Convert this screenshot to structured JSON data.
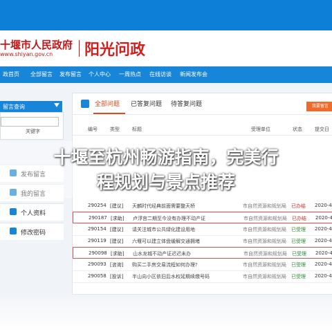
{
  "header": {
    "site_name": "十堰市人民政府",
    "site_url": "www.shiyan.gov.cn",
    "brand": "阳光问政"
  },
  "nav": [
    "政首页",
    "全部留言",
    "发布留言",
    "个人中心",
    "一周热点",
    "在线访谈",
    "新闻发布会"
  ],
  "sidebar": {
    "title": "留言查询",
    "check_label": "关键字",
    "buttons": [
      "发布留言",
      "我的留言",
      "个人资料",
      "修改密码"
    ]
  },
  "tabs": [
    "全部问题",
    "已答复问题",
    "待答复问题"
  ],
  "action_button": "我要留言",
  "table": {
    "headers": [
      "编号",
      "类型",
      "标题",
      "受理单位",
      "状态",
      "提交日"
    ],
    "rows": [
      {
        "id": "290254",
        "type": "[建议]",
        "title": "天麟时代经典前面需要整天桥",
        "dept": "市自然资源和规划局",
        "status": "已办结",
        "date": "2020-4-2",
        "highlight": false
      },
      {
        "id": "290187",
        "type": "[求助]",
        "title": "卢浮宫二期至今没有办理不动产证",
        "dept": "市自然资源和规划局",
        "status": "已办结",
        "date": "2020-4-2",
        "highlight": true
      },
      {
        "id": "290154",
        "type": "[建议]",
        "title": "请关注城市公共绿化建设用地",
        "dept": "市自然资源和规划局",
        "status": "已受理",
        "date": "2020-4-2",
        "highlight": false
      },
      {
        "id": "290119",
        "type": "[建议]",
        "title": "六堰可以建立体盘缓解交通拥堵",
        "dept": "市自然资源和规划局",
        "status": "已受理",
        "date": "2020-4-2",
        "highlight": false
      },
      {
        "id": "290098",
        "type": "[求助]",
        "title": "山水龙城不动产证迟迟未办",
        "dept": "市自然资源和规划局",
        "status": "已受理",
        "date": "2020-4-2",
        "highlight": true
      },
      {
        "id": "290093",
        "type": "[咨询]",
        "title": "购买二手房交易流程如何办理?",
        "dept": "市自然资源和规划局",
        "status": "已受理",
        "date": "2020-4-2",
        "highlight": false
      },
      {
        "id": "290058",
        "type": "[投诉]",
        "title": "半山向小区依旧后水权延期续缴号码",
        "dept": "市自然资源和规划局",
        "status": "已受理",
        "date": "2020-4-2",
        "highlight": false
      }
    ]
  },
  "overlay": {
    "line1": "十堰至杭州畅游指南，完美行",
    "line2": "程规划与景点推荐"
  },
  "colors": {
    "nav_blue": "#1785d8",
    "accent_orange": "#e04a1e",
    "status_done": "#d22d2d",
    "status_accepted": "#2e8b3a"
  }
}
